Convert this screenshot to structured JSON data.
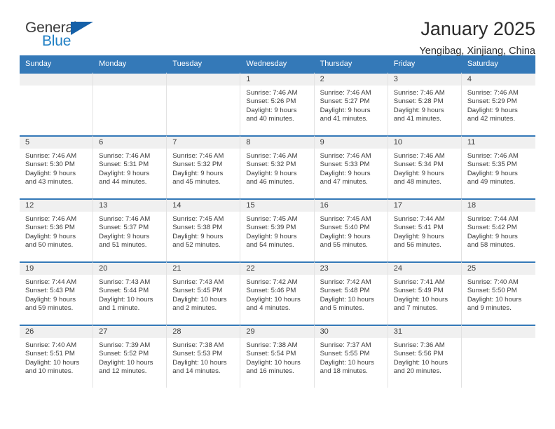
{
  "brand": {
    "name_top": "General",
    "name_bottom": "Blue",
    "accent_color": "#1560a8",
    "blue_text_color": "#1f7fc4"
  },
  "header": {
    "title": "January 2025",
    "subtitle": "Yengibag, Xinjiang, China"
  },
  "theme": {
    "header_row_bg": "#3479b8",
    "daynum_band_bg": "#f0f0f0",
    "cell_top_border": "#3479b8",
    "text_color": "#3b3b3b"
  },
  "weekday_headers": [
    "Sunday",
    "Monday",
    "Tuesday",
    "Wednesday",
    "Thursday",
    "Friday",
    "Saturday"
  ],
  "labels": {
    "sunrise_prefix": "Sunrise:",
    "sunset_prefix": "Sunset:",
    "daylight_prefix": "Daylight:"
  },
  "weeks": [
    [
      {
        "day": "",
        "empty": true
      },
      {
        "day": "",
        "empty": true
      },
      {
        "day": "",
        "empty": true
      },
      {
        "day": "1",
        "sunrise": "Sunrise: 7:46 AM",
        "sunset": "Sunset: 5:26 PM",
        "daylight_line1": "Daylight: 9 hours",
        "daylight_line2": "and 40 minutes."
      },
      {
        "day": "2",
        "sunrise": "Sunrise: 7:46 AM",
        "sunset": "Sunset: 5:27 PM",
        "daylight_line1": "Daylight: 9 hours",
        "daylight_line2": "and 41 minutes."
      },
      {
        "day": "3",
        "sunrise": "Sunrise: 7:46 AM",
        "sunset": "Sunset: 5:28 PM",
        "daylight_line1": "Daylight: 9 hours",
        "daylight_line2": "and 41 minutes."
      },
      {
        "day": "4",
        "sunrise": "Sunrise: 7:46 AM",
        "sunset": "Sunset: 5:29 PM",
        "daylight_line1": "Daylight: 9 hours",
        "daylight_line2": "and 42 minutes."
      }
    ],
    [
      {
        "day": "5",
        "sunrise": "Sunrise: 7:46 AM",
        "sunset": "Sunset: 5:30 PM",
        "daylight_line1": "Daylight: 9 hours",
        "daylight_line2": "and 43 minutes."
      },
      {
        "day": "6",
        "sunrise": "Sunrise: 7:46 AM",
        "sunset": "Sunset: 5:31 PM",
        "daylight_line1": "Daylight: 9 hours",
        "daylight_line2": "and 44 minutes."
      },
      {
        "day": "7",
        "sunrise": "Sunrise: 7:46 AM",
        "sunset": "Sunset: 5:32 PM",
        "daylight_line1": "Daylight: 9 hours",
        "daylight_line2": "and 45 minutes."
      },
      {
        "day": "8",
        "sunrise": "Sunrise: 7:46 AM",
        "sunset": "Sunset: 5:32 PM",
        "daylight_line1": "Daylight: 9 hours",
        "daylight_line2": "and 46 minutes."
      },
      {
        "day": "9",
        "sunrise": "Sunrise: 7:46 AM",
        "sunset": "Sunset: 5:33 PM",
        "daylight_line1": "Daylight: 9 hours",
        "daylight_line2": "and 47 minutes."
      },
      {
        "day": "10",
        "sunrise": "Sunrise: 7:46 AM",
        "sunset": "Sunset: 5:34 PM",
        "daylight_line1": "Daylight: 9 hours",
        "daylight_line2": "and 48 minutes."
      },
      {
        "day": "11",
        "sunrise": "Sunrise: 7:46 AM",
        "sunset": "Sunset: 5:35 PM",
        "daylight_line1": "Daylight: 9 hours",
        "daylight_line2": "and 49 minutes."
      }
    ],
    [
      {
        "day": "12",
        "sunrise": "Sunrise: 7:46 AM",
        "sunset": "Sunset: 5:36 PM",
        "daylight_line1": "Daylight: 9 hours",
        "daylight_line2": "and 50 minutes."
      },
      {
        "day": "13",
        "sunrise": "Sunrise: 7:46 AM",
        "sunset": "Sunset: 5:37 PM",
        "daylight_line1": "Daylight: 9 hours",
        "daylight_line2": "and 51 minutes."
      },
      {
        "day": "14",
        "sunrise": "Sunrise: 7:45 AM",
        "sunset": "Sunset: 5:38 PM",
        "daylight_line1": "Daylight: 9 hours",
        "daylight_line2": "and 52 minutes."
      },
      {
        "day": "15",
        "sunrise": "Sunrise: 7:45 AM",
        "sunset": "Sunset: 5:39 PM",
        "daylight_line1": "Daylight: 9 hours",
        "daylight_line2": "and 54 minutes."
      },
      {
        "day": "16",
        "sunrise": "Sunrise: 7:45 AM",
        "sunset": "Sunset: 5:40 PM",
        "daylight_line1": "Daylight: 9 hours",
        "daylight_line2": "and 55 minutes."
      },
      {
        "day": "17",
        "sunrise": "Sunrise: 7:44 AM",
        "sunset": "Sunset: 5:41 PM",
        "daylight_line1": "Daylight: 9 hours",
        "daylight_line2": "and 56 minutes."
      },
      {
        "day": "18",
        "sunrise": "Sunrise: 7:44 AM",
        "sunset": "Sunset: 5:42 PM",
        "daylight_line1": "Daylight: 9 hours",
        "daylight_line2": "and 58 minutes."
      }
    ],
    [
      {
        "day": "19",
        "sunrise": "Sunrise: 7:44 AM",
        "sunset": "Sunset: 5:43 PM",
        "daylight_line1": "Daylight: 9 hours",
        "daylight_line2": "and 59 minutes."
      },
      {
        "day": "20",
        "sunrise": "Sunrise: 7:43 AM",
        "sunset": "Sunset: 5:44 PM",
        "daylight_line1": "Daylight: 10 hours",
        "daylight_line2": "and 1 minute."
      },
      {
        "day": "21",
        "sunrise": "Sunrise: 7:43 AM",
        "sunset": "Sunset: 5:45 PM",
        "daylight_line1": "Daylight: 10 hours",
        "daylight_line2": "and 2 minutes."
      },
      {
        "day": "22",
        "sunrise": "Sunrise: 7:42 AM",
        "sunset": "Sunset: 5:46 PM",
        "daylight_line1": "Daylight: 10 hours",
        "daylight_line2": "and 4 minutes."
      },
      {
        "day": "23",
        "sunrise": "Sunrise: 7:42 AM",
        "sunset": "Sunset: 5:48 PM",
        "daylight_line1": "Daylight: 10 hours",
        "daylight_line2": "and 5 minutes."
      },
      {
        "day": "24",
        "sunrise": "Sunrise: 7:41 AM",
        "sunset": "Sunset: 5:49 PM",
        "daylight_line1": "Daylight: 10 hours",
        "daylight_line2": "and 7 minutes."
      },
      {
        "day": "25",
        "sunrise": "Sunrise: 7:40 AM",
        "sunset": "Sunset: 5:50 PM",
        "daylight_line1": "Daylight: 10 hours",
        "daylight_line2": "and 9 minutes."
      }
    ],
    [
      {
        "day": "26",
        "sunrise": "Sunrise: 7:40 AM",
        "sunset": "Sunset: 5:51 PM",
        "daylight_line1": "Daylight: 10 hours",
        "daylight_line2": "and 10 minutes."
      },
      {
        "day": "27",
        "sunrise": "Sunrise: 7:39 AM",
        "sunset": "Sunset: 5:52 PM",
        "daylight_line1": "Daylight: 10 hours",
        "daylight_line2": "and 12 minutes."
      },
      {
        "day": "28",
        "sunrise": "Sunrise: 7:38 AM",
        "sunset": "Sunset: 5:53 PM",
        "daylight_line1": "Daylight: 10 hours",
        "daylight_line2": "and 14 minutes."
      },
      {
        "day": "29",
        "sunrise": "Sunrise: 7:38 AM",
        "sunset": "Sunset: 5:54 PM",
        "daylight_line1": "Daylight: 10 hours",
        "daylight_line2": "and 16 minutes."
      },
      {
        "day": "30",
        "sunrise": "Sunrise: 7:37 AM",
        "sunset": "Sunset: 5:55 PM",
        "daylight_line1": "Daylight: 10 hours",
        "daylight_line2": "and 18 minutes."
      },
      {
        "day": "31",
        "sunrise": "Sunrise: 7:36 AM",
        "sunset": "Sunset: 5:56 PM",
        "daylight_line1": "Daylight: 10 hours",
        "daylight_line2": "and 20 minutes."
      },
      {
        "day": "",
        "empty": true
      }
    ]
  ]
}
